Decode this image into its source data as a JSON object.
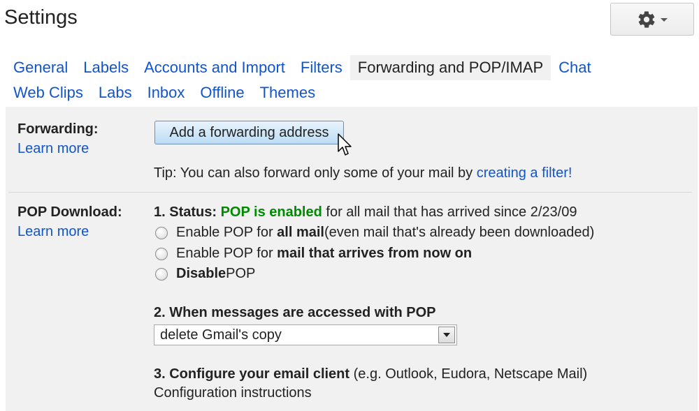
{
  "header": {
    "title": "Settings",
    "gear_icon": "gear-icon",
    "caret_icon": "chevron-down-icon"
  },
  "tabs": {
    "row1": [
      {
        "label": "General",
        "active": false
      },
      {
        "label": "Labels",
        "active": false
      },
      {
        "label": "Accounts and Import",
        "active": false
      },
      {
        "label": "Filters",
        "active": false
      },
      {
        "label": "Forwarding and POP/IMAP",
        "active": true
      },
      {
        "label": "Chat",
        "active": false
      }
    ],
    "row2": [
      {
        "label": "Web Clips",
        "active": false
      },
      {
        "label": "Labs",
        "active": false
      },
      {
        "label": "Inbox",
        "active": false
      },
      {
        "label": "Offline",
        "active": false
      },
      {
        "label": "Themes",
        "active": false
      }
    ]
  },
  "forwarding": {
    "label": "Forwarding:",
    "learn_more": "Learn more",
    "button_label": "Add a forwarding address",
    "tip_prefix": "Tip: You can also forward only some of your mail by ",
    "tip_link": "creating a filter!"
  },
  "pop": {
    "label": "POP Download:",
    "learn_more": "Learn more",
    "status_prefix": "1. Status: ",
    "status_value": "POP is enabled",
    "status_suffix": " for all mail that has arrived since 2/23/09",
    "options": [
      {
        "prefix": "Enable POP for ",
        "bold": "all mail",
        "suffix": " (even mail that's already been downloaded)"
      },
      {
        "prefix": "Enable POP for ",
        "bold": "mail that arrives from now on",
        "suffix": ""
      },
      {
        "prefix": "",
        "bold": "Disable",
        "suffix": " POP"
      }
    ],
    "access_heading": "2. When messages are accessed with POP",
    "access_selected": "delete Gmail's copy",
    "configure_heading": "3. Configure your email client",
    "configure_suffix": " (e.g. Outlook, Eudora, Netscape Mail)",
    "configure_link": "Configuration instructions"
  },
  "colors": {
    "link": "#1155cc",
    "status_green": "#008a00",
    "panel_bg": "#f1f1f1",
    "text": "#222222"
  }
}
